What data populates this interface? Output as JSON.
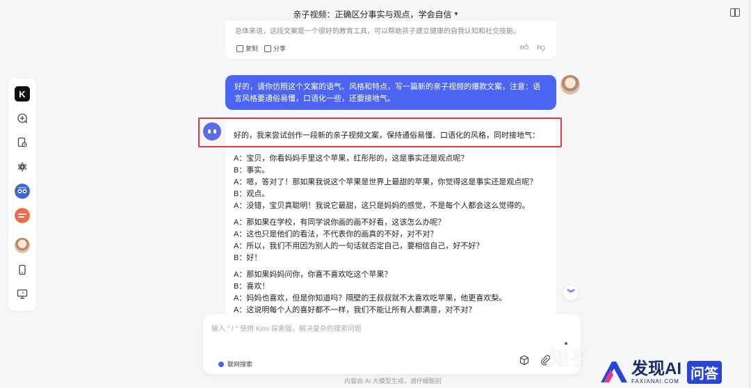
{
  "topbar": {
    "title": "亲子视频：正确区分事实与观点，学会自信"
  },
  "prev_ai": {
    "summary": "总体来说，这段文案是一个很好的教育工具，可以帮助孩子建立健康的自我认知和社交技能。",
    "copy_label": "复制",
    "share_label": "分享"
  },
  "user_message": "好的，请你仿照这个文案的语气、风格和特点，写一篇新的亲子视频的爆款文案，注意：语言风格要通俗易懂，口语化一些，还要接地气。",
  "ai_intro": "好的，我来尝试创作一段新的亲子视频文案，保持通俗易懂、口语化的风格，同时接地气：",
  "dialog": [
    [
      "A：宝贝，你看妈妈手里这个苹果，红彤彤的，这是事实还是观点呢？",
      "B：事实。",
      "A：嗯，答对了！那如果我说这个苹果是世界上最甜的苹果，你觉得这是事实还是观点呢？",
      "B：观点。",
      "A：没错，宝贝真聪明！我说它最甜，这只是妈妈的感觉，不是每个人都会这么觉得的。"
    ],
    [
      "A：那如果在学校，有同学说你画的画不好看，这该怎么办呢？",
      "A：这也只是他们的看法，不代表你的画真的不好，对不对？",
      "A：所以，我们不用因为别人的一句话就否定自己，要相信自己，好不好？",
      "B：好！"
    ],
    [
      "A：那如果妈妈问你，你喜不喜欢吃这个苹果？",
      "B：喜欢！",
      "A：妈妈也喜欢，但是你知道吗？隔壁的王叔叔就不太喜欢吃苹果，他更喜欢梨。",
      "A：这说明每个人的喜好都不一样，我们不能让所有人都满意，对不对？"
    ]
  ],
  "input": {
    "placeholder": "输入 \" / \" 使用 Kimi 探索版，解决复杂的搜索问题",
    "net_search_label": "联网搜索"
  },
  "footer": "内容由 AI 大模型生成，请仔细甄别",
  "watermark": {
    "zhihu": "知乎",
    "brand": "发现AI",
    "brand_small": "FAXIANAI.COM",
    "qa": "问答"
  },
  "colors": {
    "accent": "#4b64f2",
    "highlight": "#e0393e"
  }
}
